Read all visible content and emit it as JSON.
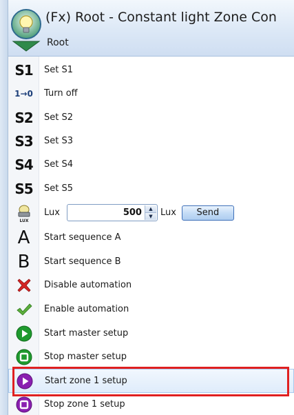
{
  "header": {
    "title": "(Fx) Root - Constant light Zone Con",
    "subtitle": "Root",
    "icon": "lightbulb-icon"
  },
  "menu": {
    "items": [
      {
        "label": "Set S1",
        "icon_text": "S1",
        "icon": "s1-icon"
      },
      {
        "label": "Turn off",
        "icon_text": "1→0",
        "icon": "turn-off-icon"
      },
      {
        "label": "Set S2",
        "icon_text": "S2",
        "icon": "s2-icon"
      },
      {
        "label": "Set S3",
        "icon_text": "S3",
        "icon": "s3-icon"
      },
      {
        "label": "Set S4",
        "icon_text": "S4",
        "icon": "s4-icon"
      },
      {
        "label": "Set S5",
        "icon_text": "S5",
        "icon": "s5-icon"
      },
      {
        "label": "Start sequence A",
        "icon_text": "A",
        "icon": "letter-a-icon"
      },
      {
        "label": "Start sequence B",
        "icon_text": "B",
        "icon": "letter-b-icon"
      },
      {
        "label": "Disable automation",
        "icon": "red-x-icon"
      },
      {
        "label": "Enable automation",
        "icon": "green-check-icon"
      },
      {
        "label": "Start master setup",
        "icon": "green-play-icon"
      },
      {
        "label": "Stop master setup",
        "icon": "green-stop-icon"
      },
      {
        "label": "Start zone 1 setup",
        "icon": "purple-play-icon"
      },
      {
        "label": "Stop zone 1 setup",
        "icon": "purple-stop-icon"
      }
    ],
    "lux_row": {
      "label": "Lux",
      "value": "500",
      "unit": "Lux",
      "send_label": "Send",
      "icon_text": "LUX",
      "icon": "lux-sensor-icon"
    }
  },
  "colors": {
    "highlight_border": "#e02020",
    "green_icon": "#1e9a2e",
    "purple_icon": "#8a1fb0",
    "red_icon": "#d42626",
    "header_bg": "#dce8f6"
  }
}
